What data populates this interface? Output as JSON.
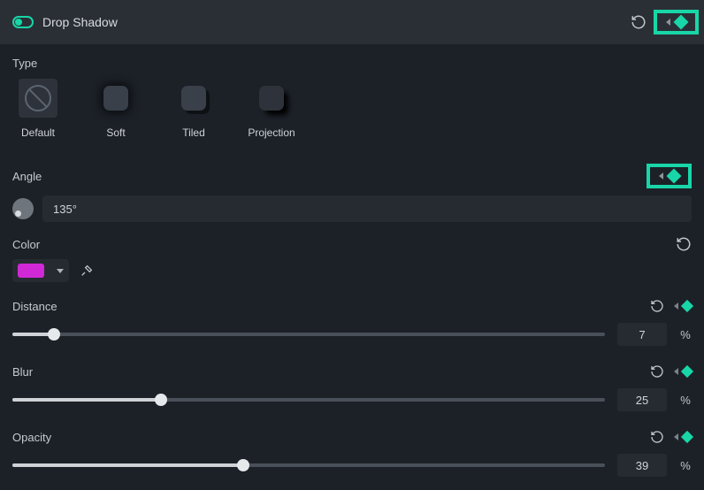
{
  "header": {
    "title": "Drop Shadow"
  },
  "type": {
    "label": "Type",
    "items": [
      {
        "label": "Default"
      },
      {
        "label": "Soft"
      },
      {
        "label": "Tiled"
      },
      {
        "label": "Projection"
      }
    ]
  },
  "angle": {
    "label": "Angle",
    "value": "135°"
  },
  "color": {
    "label": "Color",
    "value_hex": "#d128d6"
  },
  "distance": {
    "label": "Distance",
    "value": "7",
    "unit": "%",
    "percent": 7
  },
  "blur": {
    "label": "Blur",
    "value": "25",
    "unit": "%",
    "percent": 25
  },
  "opacity": {
    "label": "Opacity",
    "value": "39",
    "unit": "%",
    "percent": 39
  }
}
